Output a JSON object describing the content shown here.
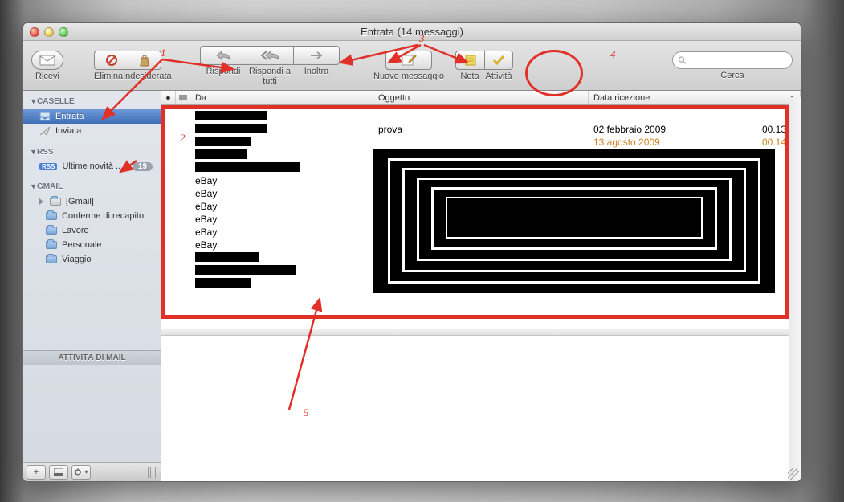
{
  "window": {
    "title": "Entrata (14 messaggi)"
  },
  "toolbar": {
    "receive": "Ricevi",
    "delete": "Elimina",
    "junk": "Indesiderata",
    "reply": "Rispondi",
    "reply_all": "Rispondi a tutti",
    "forward": "Inoltra",
    "new_message": "Nuovo messaggio",
    "note": "Nota",
    "activity": "Attività",
    "search_label": "Cerca",
    "search_placeholder": ""
  },
  "sidebar": {
    "mailboxes_header": "CASELLE",
    "inbox": "Entrata",
    "sent": "Inviata",
    "rss_header": "RSS",
    "rss_item": "Ultime novità ...",
    "rss_count": "19",
    "gmail_header": "GMAIL",
    "gmail_folder": "[Gmail]",
    "folders": [
      "Conferme di recapito",
      "Lavoro",
      "Personale",
      "Viaggio"
    ],
    "activity_header": "ATTIVITÀ DI MAIL"
  },
  "columns": {
    "from": "Da",
    "subject": "Oggetto",
    "date": "Data ricezione"
  },
  "messages": [
    {
      "from_redacted_w": 90,
      "subject": "",
      "date": "",
      "time": ""
    },
    {
      "from_redacted_w": 90,
      "subject": "prova",
      "date": "02 febbraio 2009",
      "time": "00.13"
    },
    {
      "from_redacted_w": 70,
      "subject": "",
      "date": "13 agosto 2009",
      "time": "00.14",
      "orange": true
    },
    {
      "from_redacted_w": 65,
      "subject": "",
      "date": "",
      "time": ""
    },
    {
      "from_redacted_w": 130,
      "subject": "",
      "date": "",
      "time": ""
    },
    {
      "from_text": "eBay",
      "subject": "",
      "date": "",
      "time": ""
    },
    {
      "from_text": "eBay",
      "subject": "",
      "date": "",
      "time": ""
    },
    {
      "from_text": "eBay",
      "subject": "",
      "date": "",
      "time": ""
    },
    {
      "from_text": "eBay",
      "subject": "",
      "date": "",
      "time": ""
    },
    {
      "from_text": "eBay",
      "subject": "",
      "date": "",
      "time": ""
    },
    {
      "from_text": "eBay",
      "subject": "",
      "date": "",
      "time": ""
    },
    {
      "from_redacted_w": 80,
      "subject": "",
      "date": "",
      "time": ""
    },
    {
      "from_redacted_w": 125,
      "subject": "",
      "date": "",
      "time": ""
    },
    {
      "from_redacted_w": 70,
      "subject": "",
      "date": "",
      "time": ""
    }
  ],
  "annotations": {
    "n1": "1",
    "n2": "2",
    "n3": "3",
    "n4": "4",
    "n5": "5"
  }
}
